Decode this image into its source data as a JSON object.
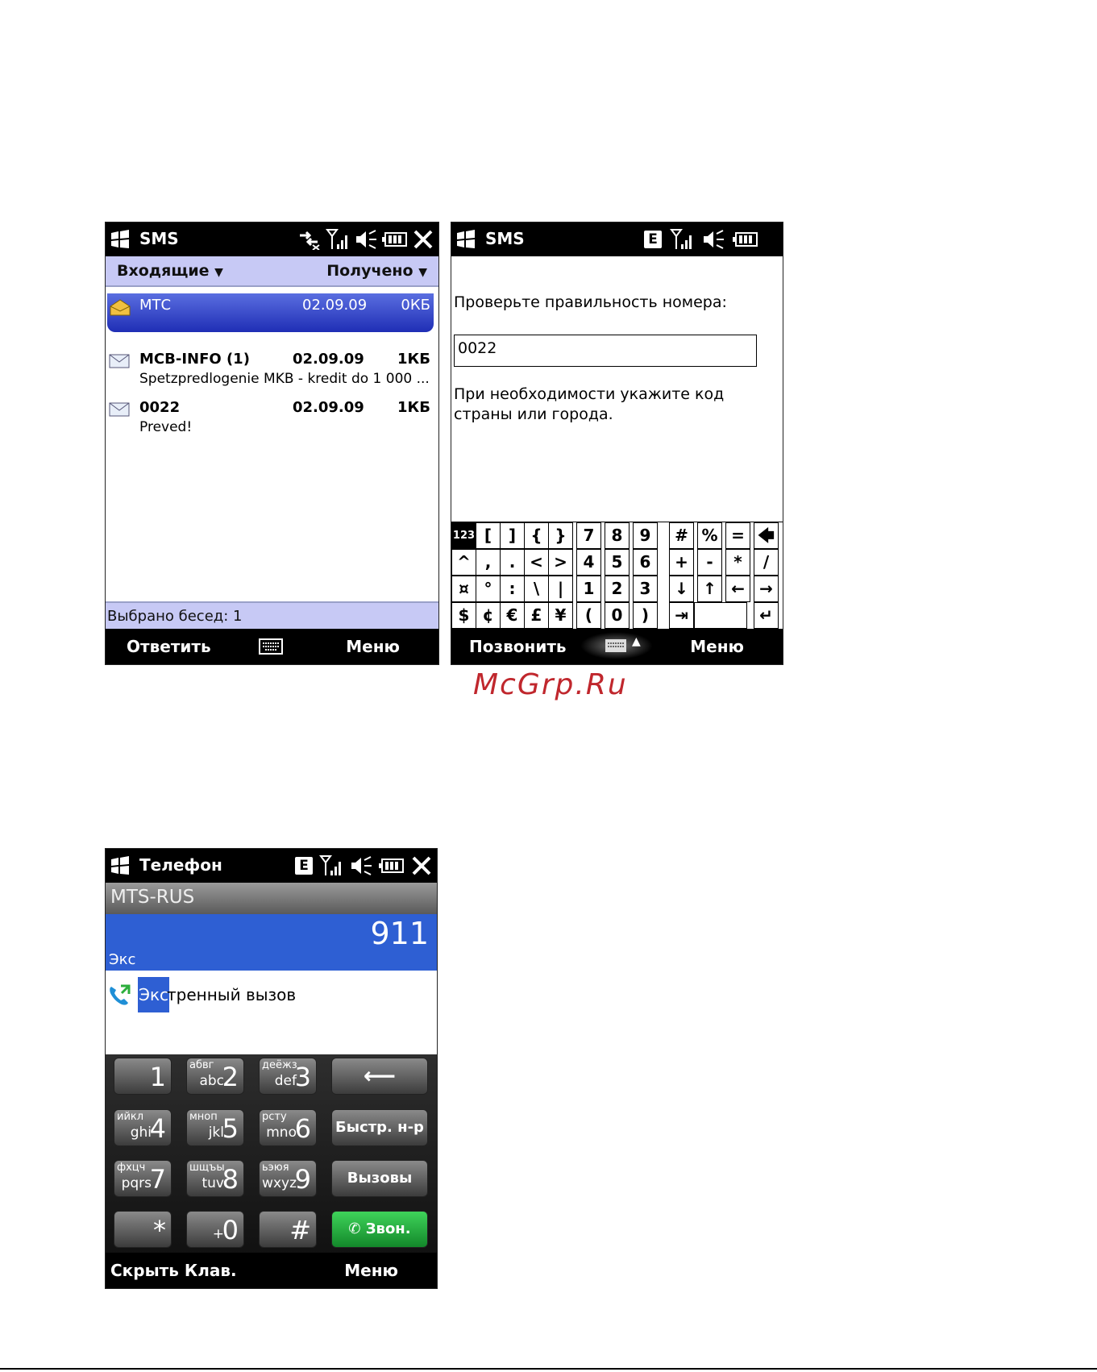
{
  "screen1": {
    "title": "SMS",
    "folder": "Входящие",
    "sort": "Получено",
    "messages": [
      {
        "sender": "МТС",
        "date": "02.09.09",
        "size": "0КБ",
        "preview": ""
      },
      {
        "sender": "MCB-INFO (1)",
        "date": "02.09.09",
        "size": "1КБ",
        "preview": "Spetzpredlogenie  MKB -  kredit do 1 000 ..."
      },
      {
        "sender": "0022",
        "date": "02.09.09",
        "size": "1КБ",
        "preview": "Preved!"
      }
    ],
    "status_text": "Выбрано бесед: 1",
    "soft_left": "Ответить",
    "soft_right": "Меню"
  },
  "screen2": {
    "title": "SMS",
    "prompt": "Проверьте правильность номера:",
    "number_value": "0022",
    "hint_line1": "При необходимости укажите код",
    "hint_line2": "страны или города.",
    "keys": {
      "r1": [
        "123",
        "[",
        "]",
        "{",
        "}",
        "7",
        "8",
        "9",
        "#",
        "%",
        "=",
        "🡄"
      ],
      "r2": [
        "^",
        ",",
        ".",
        "<",
        ">",
        "4",
        "5",
        "6",
        "+",
        "-",
        "*",
        "/"
      ],
      "r3": [
        "¤",
        "°",
        ":",
        "\\",
        "|",
        "1",
        "2",
        "3",
        "↓",
        "↑",
        "←",
        "→"
      ],
      "r4": [
        "$",
        "¢",
        "€",
        "£",
        "¥",
        "(",
        "0",
        ")",
        "⇥",
        "",
        "↵"
      ]
    },
    "soft_left": "Позвонить",
    "soft_right": "Меню"
  },
  "screen3": {
    "title": "Телефон",
    "operator": "MTS-RUS",
    "dialed": "911",
    "typed": "Экс",
    "suggest_highlight": "Экс",
    "suggest_rest": "тренный вызов",
    "keys": [
      {
        "digit": "1",
        "cyr": "",
        "lat": ""
      },
      {
        "digit": "2",
        "cyr": "абвг",
        "lat": "abc"
      },
      {
        "digit": "3",
        "cyr": "деёжз",
        "lat": "def"
      },
      {
        "digit": "4",
        "cyr": "ийкл",
        "lat": "ghi"
      },
      {
        "digit": "5",
        "cyr": "мноп",
        "lat": "jkl"
      },
      {
        "digit": "6",
        "cyr": "рсту",
        "lat": "mno"
      },
      {
        "digit": "7",
        "cyr": "фхцч",
        "lat": "pqrs"
      },
      {
        "digit": "8",
        "cyr": "шщъы",
        "lat": "tuv"
      },
      {
        "digit": "9",
        "cyr": "ьэюя",
        "lat": "wxyz"
      },
      {
        "digit": "*",
        "cyr": "",
        "lat": ""
      },
      {
        "digit": "0",
        "cyr": "",
        "lat": "+"
      },
      {
        "digit": "#",
        "cyr": "",
        "lat": ""
      }
    ],
    "speed_dial": "Быстр. н-р",
    "calls": "Вызовы",
    "call": "Звон.",
    "soft_left": "Скрыть Клав.",
    "soft_right": "Меню"
  },
  "watermark": "McGrp.Ru",
  "colors": {
    "selection": "#1f2eb5",
    "header_band": "#c7c9f5",
    "dial_blue": "#2e5fd3",
    "call_green": "#1ea33a",
    "watermark": "#c0272d"
  }
}
